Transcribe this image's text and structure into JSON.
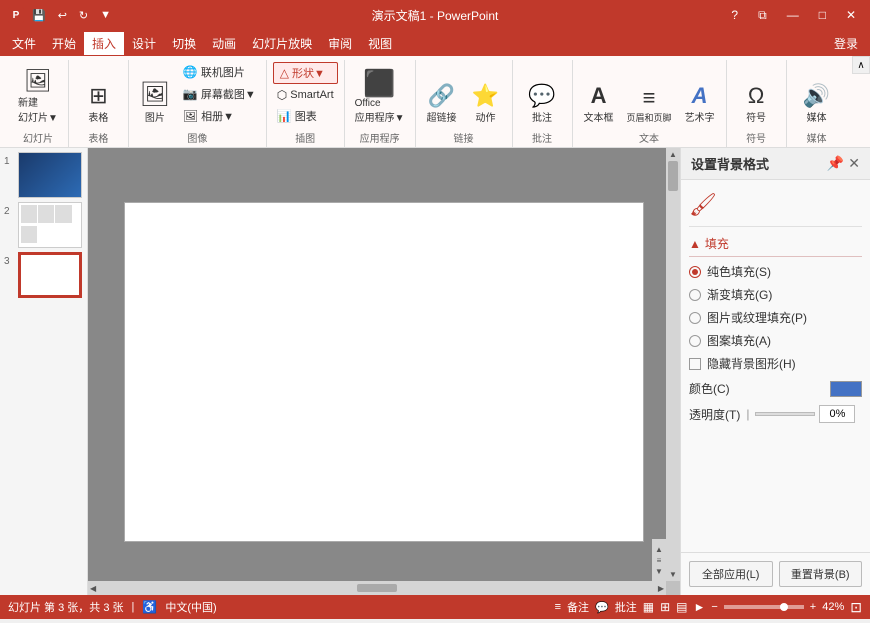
{
  "titleBar": {
    "appName": "演示文稿1 - PowerPoint",
    "helpBtn": "?",
    "restoreBtn": "⧉",
    "minBtn": "—",
    "maxBtn": "□",
    "closeBtn": "✕",
    "quickSave": "💾",
    "quickUndo": "↩",
    "quickRedo": "↻",
    "quickMore": "▼"
  },
  "menuBar": {
    "items": [
      "文件",
      "开始",
      "插入",
      "设计",
      "切换",
      "动画",
      "幻灯片放映",
      "审阅",
      "视图"
    ],
    "activeItem": "插入",
    "loginBtn": "登录"
  },
  "ribbon": {
    "groups": [
      {
        "name": "幻灯片",
        "label": "幻灯片",
        "items": [
          {
            "label": "新建\n幻灯片▼",
            "icon": "🖼"
          }
        ]
      },
      {
        "name": "表格",
        "label": "表格",
        "items": [
          {
            "label": "表格",
            "icon": "⊞"
          }
        ]
      },
      {
        "name": "图像",
        "label": "图像",
        "items": [
          {
            "label": "图片",
            "icon": "🖼"
          },
          {
            "label": "联机图片",
            "sublabel": "屏幕截图▼",
            "subitem2": "相册▼"
          }
        ]
      },
      {
        "name": "插图",
        "label": "插图",
        "items": [
          {
            "label": "形状▼",
            "icon": "△",
            "highlighted": true
          },
          {
            "label": "SmartArt",
            "icon": "⬡"
          },
          {
            "label": "图表",
            "icon": "📊"
          }
        ]
      },
      {
        "name": "应用程序",
        "label": "应用程序",
        "items": [
          {
            "label": "Office\n应用程序▼",
            "icon": "🔷"
          }
        ]
      },
      {
        "name": "链接",
        "label": "链接",
        "items": [
          {
            "label": "超链接",
            "icon": "🔗"
          },
          {
            "label": "动作",
            "icon": "⭐"
          }
        ]
      },
      {
        "name": "批注",
        "label": "批注",
        "items": [
          {
            "label": "批注",
            "icon": "💬"
          }
        ]
      },
      {
        "name": "文本",
        "label": "文本",
        "items": [
          {
            "label": "文本框",
            "icon": "A"
          },
          {
            "label": "页眉和页脚",
            "icon": "≡"
          },
          {
            "label": "艺术字",
            "icon": "A"
          }
        ]
      },
      {
        "name": "符号",
        "label": "符号",
        "items": [
          {
            "label": "符号",
            "icon": "Ω"
          }
        ]
      },
      {
        "name": "媒体",
        "label": "媒体",
        "items": [
          {
            "label": "媒体",
            "icon": "🔊"
          }
        ]
      }
    ],
    "scrollBtn": "∧"
  },
  "slides": [
    {
      "num": "1",
      "selected": false
    },
    {
      "num": "2",
      "selected": false
    },
    {
      "num": "3",
      "selected": true
    }
  ],
  "bgPanel": {
    "title": "设置背景格式",
    "closeBtn": "✕",
    "sections": [
      {
        "name": "填充",
        "label": "▲ 填充",
        "options": [
          {
            "label": "纯色填充(S)",
            "checked": true
          },
          {
            "label": "渐变填充(G)",
            "checked": false
          },
          {
            "label": "图片或纹理填充(P)",
            "checked": false
          },
          {
            "label": "图案填充(A)",
            "checked": false
          }
        ],
        "checkbox": "隐藏背景图形(H)"
      }
    ],
    "colorLabel": "颜色(C)",
    "transparencyLabel": "透明度(T)",
    "transparencySlider": "|",
    "transparencyValue": "0%",
    "btnApplyAll": "全部应用(L)",
    "btnReset": "重置背景(B)"
  },
  "statusBar": {
    "slideInfo": "幻灯片 第 3 张，共 3 张",
    "lang": "中文(中国)",
    "notes": "备注",
    "comments": "批注",
    "viewIcons": [
      "▦",
      "⊞",
      "▤",
      "►"
    ],
    "zoomLevel": "42%",
    "fitBtn": "⊡"
  }
}
